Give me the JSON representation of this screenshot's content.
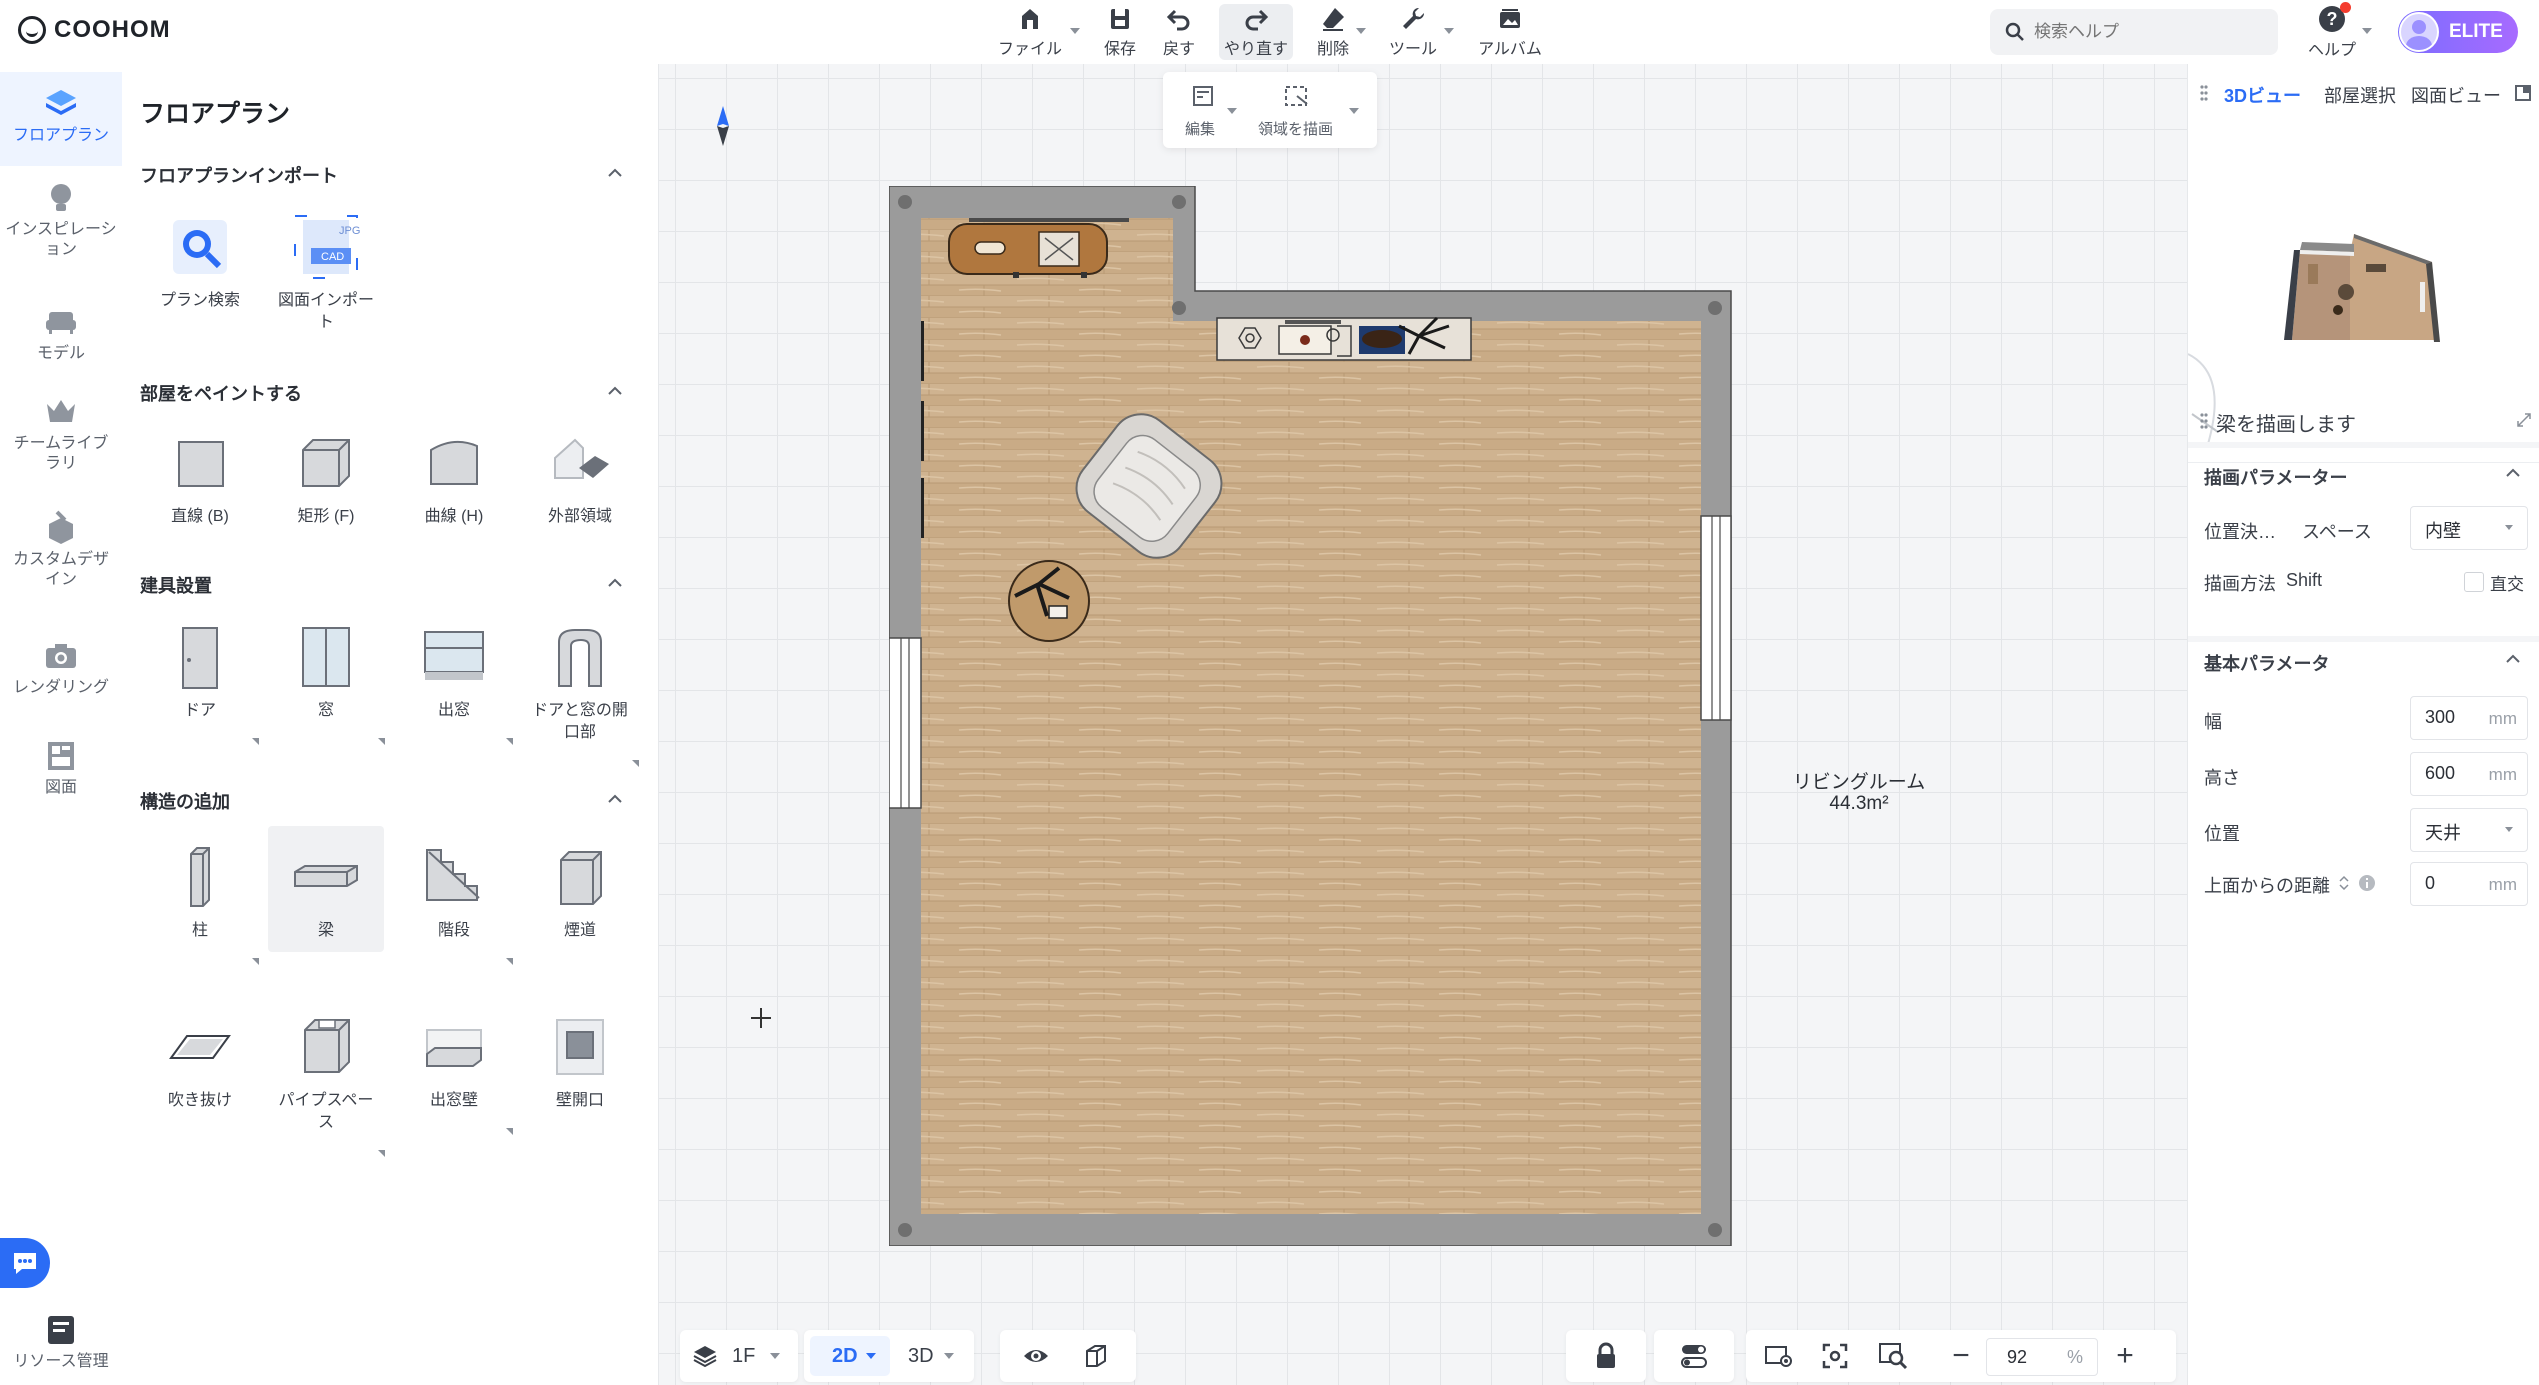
{
  "app": {
    "logo": "COOHOM"
  },
  "toolbar": {
    "file": "ファイル",
    "save": "保存",
    "undo": "戻す",
    "redo": "やり直す",
    "delete": "削除",
    "tools": "ツール",
    "album": "アルバム"
  },
  "search": {
    "placeholder": "検索ヘルプ"
  },
  "help": "ヘルプ",
  "badge": "ELITE",
  "subtoolbar": {
    "edit": "編集",
    "draw_area": "領域を描画"
  },
  "rail": [
    {
      "label": "フロアプラン",
      "icon": "floorplan-icon",
      "active": true
    },
    {
      "label": "インスピレーション",
      "icon": "lightbulb-icon"
    },
    {
      "label": "モデル",
      "icon": "sofa-icon"
    },
    {
      "label": "チームライブラリ",
      "icon": "crown-icon"
    },
    {
      "label": "カスタムデザイン",
      "icon": "custom-design-icon"
    },
    {
      "label": "レンダリング",
      "icon": "camera-icon"
    },
    {
      "label": "図面",
      "icon": "drawing-icon"
    },
    {
      "label": "リソース管理",
      "icon": "resource-icon"
    }
  ],
  "left_panel": {
    "title": "フロアプラン",
    "sections": {
      "import": {
        "title": "フロアプランインポート",
        "items": [
          "プラン検索",
          "図面インポート"
        ]
      },
      "paint": {
        "title": "部屋をペイントする",
        "items": [
          "直線 (B)",
          "矩形 (F)",
          "曲線 (H)",
          "外部領域"
        ]
      },
      "fixtures": {
        "title": "建具設置",
        "items": [
          "ドア",
          "窓",
          "出窓",
          "ドアと窓の開口部"
        ]
      },
      "structure": {
        "title": "構造の追加",
        "items": [
          "柱",
          "梁",
          "階段",
          "煙道",
          "吹き抜け",
          "パイプスペース",
          "出窓壁",
          "壁開口"
        ]
      }
    },
    "import_icon_labels": {
      "jpg": "JPG",
      "cad": "CAD"
    }
  },
  "canvas": {
    "room_name": "リビングルーム",
    "room_area": "44.3m²"
  },
  "right_panel": {
    "tabs": [
      "3Dビュー",
      "部屋選択",
      "図面ビュー"
    ],
    "active_tab": "3Dビュー",
    "tool_title": "梁を描画します",
    "draw_params": {
      "title": "描画パラメーター",
      "position_label": "位置決…",
      "space_label": "スペース",
      "space_value": "内壁",
      "method_label": "描画方法",
      "method_key": "Shift",
      "ortho_label": "直交",
      "ortho_checked": false
    },
    "basic_params": {
      "title": "基本パラメータ",
      "width_label": "幅",
      "width_value": "300",
      "width_unit": "mm",
      "height_label": "高さ",
      "height_value": "600",
      "height_unit": "mm",
      "position_label": "位置",
      "position_value": "天井",
      "top_distance_label": "上面からの距離",
      "top_distance_value": "0",
      "top_distance_unit": "mm"
    }
  },
  "bottom_bar": {
    "floor": "1F",
    "view_2d": "2D",
    "view_3d": "3D",
    "zoom_value": "92",
    "zoom_unit": "%"
  },
  "colors": {
    "accent": "#2b6cf5",
    "elite_start": "#7b6cff",
    "wall": "#9b9b9b",
    "floor": "#c9ab86"
  }
}
